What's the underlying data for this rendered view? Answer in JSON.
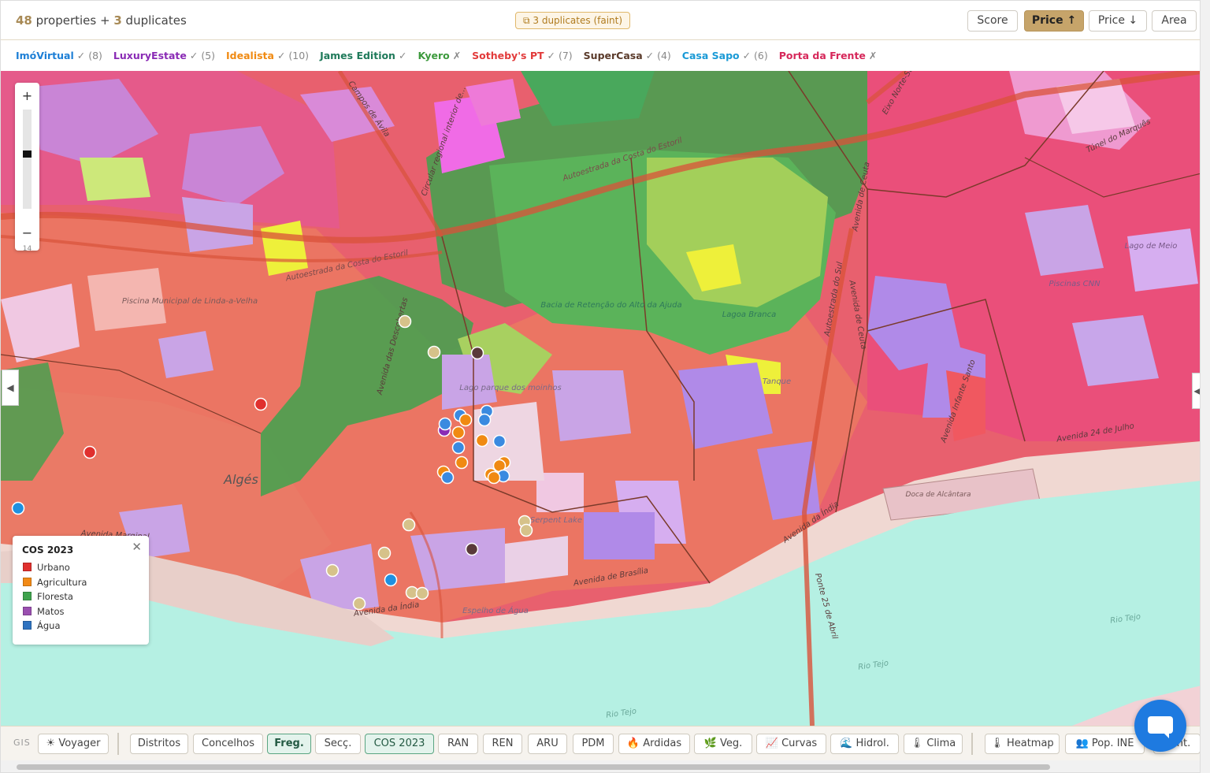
{
  "header": {
    "properties_count": "48",
    "properties_text": "properties +",
    "duplicates_count": "3",
    "duplicates_text": "duplicates",
    "duplicates_chip": "⧉ 3 duplicates (faint)",
    "sort_buttons": [
      {
        "label": "Score",
        "active": false
      },
      {
        "label": "Price ↑",
        "active": true
      },
      {
        "label": "Price ↓",
        "active": false
      },
      {
        "label": "Area",
        "active": false
      }
    ]
  },
  "sources": [
    {
      "name": "ImóVirtual",
      "mark": "✓ (8)",
      "color": "#1d7fd6"
    },
    {
      "name": "LuxuryEstate",
      "mark": "✓ (5)",
      "color": "#8a2bb5"
    },
    {
      "name": "Idealista",
      "mark": "✓ (10)",
      "color": "#f08a12"
    },
    {
      "name": "James Edition",
      "mark": "✓",
      "color": "#1f7a5a"
    },
    {
      "name": "Kyero",
      "mark": "✗",
      "color": "#3d9a3d"
    },
    {
      "name": "Sotheby's PT",
      "mark": "✓ (7)",
      "color": "#e23b3b"
    },
    {
      "name": "SuperCasa",
      "mark": "✓ (4)",
      "color": "#5a3a2a"
    },
    {
      "name": "Casa Sapo",
      "mark": "✓ (6)",
      "color": "#1a9ad6"
    },
    {
      "name": "Porta da Frente",
      "mark": "✗",
      "color": "#d6285a"
    }
  ],
  "map": {
    "zoom_in": "+",
    "zoom_out": "−",
    "zoom_level": "14",
    "left_tab": "◀",
    "right_tab": "◀",
    "labels": {
      "algés": "Algés",
      "piscina": "Piscina Municipal de Linda-a-Velha",
      "autoestrada1": "Autoestrada da Costa do Estoril",
      "autoestrada2": "Autoestrada da Costa do Estoril",
      "circular": "Circular regional interior de...",
      "campos": "Campos de Ávila",
      "descobertas": "Avenida das Descobertas",
      "lago": "Lago parque dos moinhos",
      "bacia": "Bacia de Retenção do Alto da Ajuda",
      "lagoa": "Lagoa Branca",
      "tanque": "Tanque",
      "ceuta": "Avenida de Ceuta",
      "autoestrada_sul": "Autoestrada do Sul",
      "caconta": "Avenida de Ceuta",
      "eixo": "Eixo Norte-Sul",
      "tunel": "Túnel do Marquês",
      "lago_meio": "Lago de Meio",
      "piscina_cnn": "Piscinas CNN",
      "infante": "Avenida Infante Santo",
      "julho": "Avenida 24 de Julho",
      "doca": "Doca de Alcântara",
      "india1": "Avenida da Índia",
      "india2": "Avenida da Índia",
      "brasilia": "Avenida de Brasília",
      "marginal": "Avenida Marginal",
      "espelho": "Espelho de Água",
      "serpent": "Serpent Lake",
      "ponte": "Ponte 25 de Abril",
      "tejo1": "Rio Tejo",
      "tejo2": "Rio Tejo",
      "tejo3": "Rio Tejo"
    }
  },
  "legend": {
    "title": "COS 2023",
    "close": "✕",
    "items": [
      {
        "label": "Urbano",
        "color": "#e0302e"
      },
      {
        "label": "Agricultura",
        "color": "#f28a16"
      },
      {
        "label": "Floresta",
        "color": "#3fa34d"
      },
      {
        "label": "Matos",
        "color": "#9a4fb0"
      },
      {
        "label": "Água",
        "color": "#2f73c0"
      }
    ]
  },
  "bottom": {
    "gis_label": "GIS",
    "layers": [
      {
        "label": "☀ Voyager",
        "state": "off"
      },
      {
        "label": "Distritos",
        "state": "off"
      },
      {
        "label": "Concelhos",
        "state": "off"
      },
      {
        "label": "Freg.",
        "state": "on"
      },
      {
        "label": "Secç.",
        "state": "off"
      },
      {
        "label": "COS 2023",
        "state": "on2"
      },
      {
        "label": "RAN",
        "state": "off"
      },
      {
        "label": "REN",
        "state": "off"
      },
      {
        "label": "ARU",
        "state": "off"
      },
      {
        "label": "PDM",
        "state": "off"
      },
      {
        "label": "🔥 Ardidas",
        "state": "off"
      },
      {
        "label": "🌿 Veg.",
        "state": "off"
      },
      {
        "label": "📈 Curvas",
        "state": "off"
      },
      {
        "label": "🌊 Hidrol.",
        "state": "off"
      },
      {
        "label": "🌡 Clima",
        "state": "off"
      },
      {
        "label": "🌡 Heatmap",
        "state": "off"
      },
      {
        "label": "👥 Pop. INE",
        "state": "off"
      },
      {
        "label": "Cont.",
        "state": "off"
      }
    ]
  },
  "colors": {
    "urban_pink": "#e8606e",
    "water": "#b5f0e3",
    "accent_gold": "#c6a46a"
  }
}
